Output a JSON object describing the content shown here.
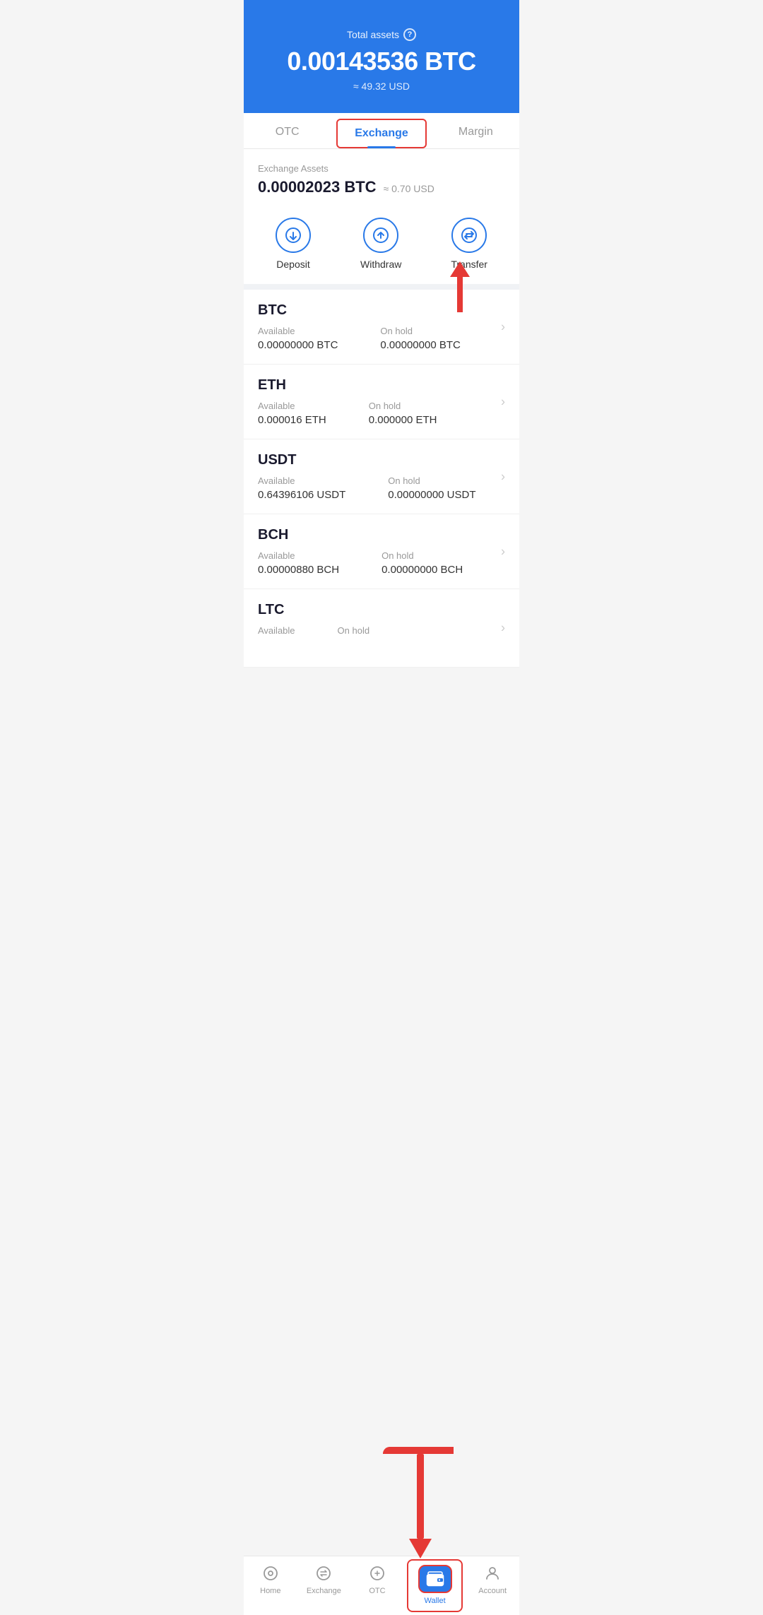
{
  "header": {
    "total_label": "Total assets",
    "btc_amount": "0.00143536 BTC",
    "usd_amount": "≈ 49.32 USD"
  },
  "tabs": [
    {
      "id": "otc",
      "label": "OTC",
      "active": false
    },
    {
      "id": "exchange",
      "label": "Exchange",
      "active": true
    },
    {
      "id": "margin",
      "label": "Margin",
      "active": false
    }
  ],
  "exchange_assets": {
    "label": "Exchange Assets",
    "amount": "0.00002023 BTC",
    "usd": "≈ 0.70 USD"
  },
  "actions": [
    {
      "id": "deposit",
      "label": "Deposit"
    },
    {
      "id": "withdraw",
      "label": "Withdraw"
    },
    {
      "id": "transfer",
      "label": "Transfer"
    }
  ],
  "coins": [
    {
      "name": "BTC",
      "available_label": "Available",
      "available_value": "0.00000000 BTC",
      "onhold_label": "On hold",
      "onhold_value": "0.00000000 BTC"
    },
    {
      "name": "ETH",
      "available_label": "Available",
      "available_value": "0.000016 ETH",
      "onhold_label": "On hold",
      "onhold_value": "0.000000 ETH"
    },
    {
      "name": "USDT",
      "available_label": "Available",
      "available_value": "0.64396106 USDT",
      "onhold_label": "On hold",
      "onhold_value": "0.00000000 USDT"
    },
    {
      "name": "BCH",
      "available_label": "Available",
      "available_value": "0.00000880 BCH",
      "onhold_label": "On hold",
      "onhold_value": "0.00000000 BCH"
    },
    {
      "name": "LTC",
      "available_label": "Available",
      "available_value": "",
      "onhold_label": "On hold",
      "onhold_value": ""
    }
  ],
  "bottom_nav": [
    {
      "id": "home",
      "label": "Home",
      "active": false
    },
    {
      "id": "exchange",
      "label": "Exchange",
      "active": false
    },
    {
      "id": "otc",
      "label": "OTC",
      "active": false
    },
    {
      "id": "wallet",
      "label": "Wallet",
      "active": true
    },
    {
      "id": "account",
      "label": "Account",
      "active": false
    }
  ]
}
